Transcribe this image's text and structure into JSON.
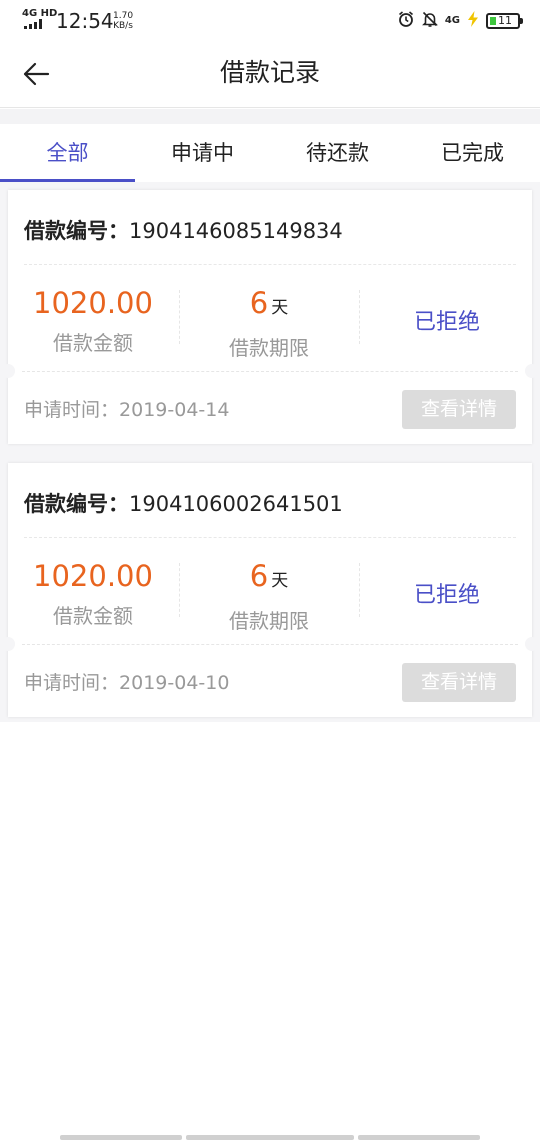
{
  "status_bar": {
    "network": "4G HD",
    "time": "12:54",
    "speed_value": "1.70",
    "speed_unit": "KB/s",
    "cellular_right": "4G",
    "battery_level": "11",
    "icons": [
      "alarm-icon",
      "bell-off-icon",
      "charging-icon"
    ]
  },
  "header": {
    "title": "借款记录",
    "back_icon": "arrow-left-icon"
  },
  "tabs": [
    {
      "label": "全部",
      "active": true
    },
    {
      "label": "申请中",
      "active": false
    },
    {
      "label": "待还款",
      "active": false
    },
    {
      "label": "已完成",
      "active": false
    }
  ],
  "colors": {
    "accent": "#4a4fc7",
    "amount": "#e8641f",
    "muted": "#999999",
    "button_disabled": "#dcdcdc"
  },
  "loans": [
    {
      "number_label": "借款编号：",
      "number": "1904146085149834",
      "amount": "1020.00",
      "amount_label": "借款金额",
      "term_value": "6",
      "term_unit": "天",
      "term_label": "借款期限",
      "status": "已拒绝",
      "apply_time_label": "申请时间：",
      "apply_time": "2019-04-14",
      "detail_button": "查看详情"
    },
    {
      "number_label": "借款编号：",
      "number": "1904106002641501",
      "amount": "1020.00",
      "amount_label": "借款金额",
      "term_value": "6",
      "term_unit": "天",
      "term_label": "借款期限",
      "status": "已拒绝",
      "apply_time_label": "申请时间：",
      "apply_time": "2019-04-10",
      "detail_button": "查看详情"
    }
  ]
}
